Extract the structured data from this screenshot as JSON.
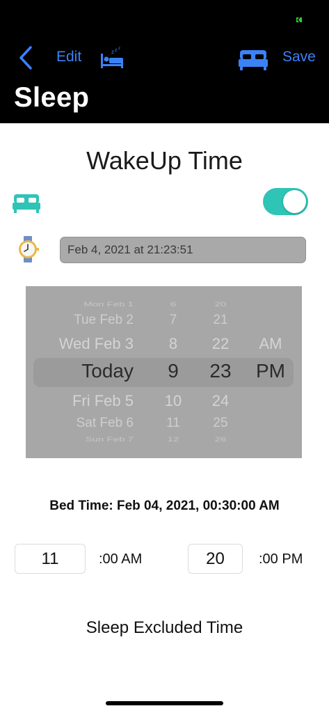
{
  "colors": {
    "accent_blue": "#3b82f6",
    "teal": "#2ec4b6",
    "header_bg": "#000000",
    "picker_bg": "#a7a7a7"
  },
  "nav": {
    "back_icon": "chevron-left-icon",
    "edit_label": "Edit",
    "sleep_icon": "sleeping-bed-icon",
    "bed_icon": "bed-icon",
    "save_label": "Save"
  },
  "page": {
    "title": "Sleep"
  },
  "wakeup": {
    "title": "WakeUp Time",
    "bed_icon": "bed-icon",
    "toggle_on": true,
    "watch_icon": "watch-icon",
    "date_value": "Feb 4, 2021 at 21:23:51"
  },
  "picker": {
    "days": [
      "Mon Feb 1",
      "Tue Feb 2",
      "Wed Feb 3",
      "Today",
      "Fri Feb 5",
      "Sat Feb 6",
      "Sun Feb 7"
    ],
    "hours": [
      "6",
      "7",
      "8",
      "9",
      "10",
      "11",
      "12"
    ],
    "minutes": [
      "20",
      "21",
      "22",
      "23",
      "24",
      "25",
      "26"
    ],
    "ampm": [
      "AM",
      "PM"
    ],
    "selected": {
      "day": "Today",
      "hour": "9",
      "minute": "23",
      "ampm": "PM"
    }
  },
  "bed_time": {
    "text": "Bed Time: Feb 04, 2021, 00:30:00 AM"
  },
  "times": {
    "left_value": "11",
    "left_suffix": ":00 AM",
    "right_value": "20",
    "right_suffix": ":00 PM"
  },
  "excluded": {
    "title": "Sleep Excluded Time"
  }
}
